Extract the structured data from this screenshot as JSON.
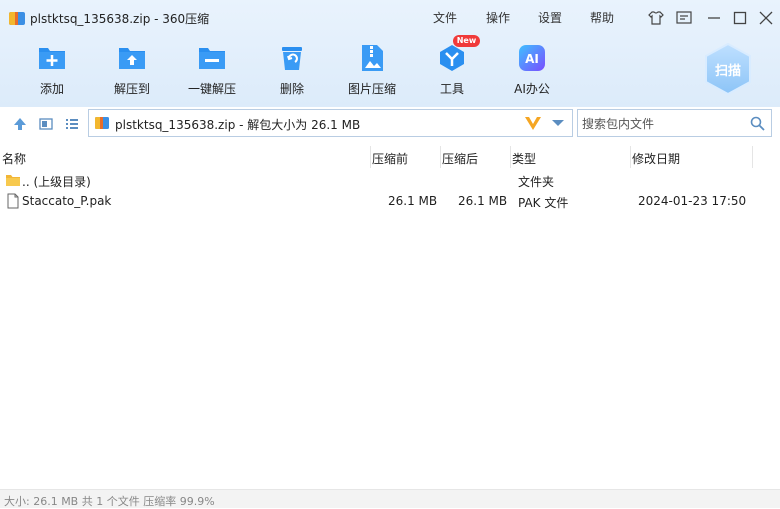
{
  "window": {
    "title": "plstktsq_135638.zip - 360压缩",
    "menu": [
      "文件",
      "操作",
      "设置",
      "帮助"
    ]
  },
  "toolbar": {
    "items": [
      {
        "label": "添加",
        "icon": "add-icon"
      },
      {
        "label": "解压到",
        "icon": "extract-to-icon"
      },
      {
        "label": "一键解压",
        "icon": "one-click-extract-icon"
      },
      {
        "label": "删除",
        "icon": "delete-icon"
      },
      {
        "label": "图片压缩",
        "icon": "image-compress-icon"
      },
      {
        "label": "工具",
        "icon": "tools-icon"
      },
      {
        "label": "AI办公",
        "icon": "ai-office-icon"
      }
    ],
    "badge": "New",
    "scan_label": "扫描"
  },
  "address": {
    "path_text": "plstktsq_135638.zip - 解包大小为 26.1 MB"
  },
  "search": {
    "placeholder": "搜索包内文件"
  },
  "table": {
    "columns": [
      "名称",
      "压缩前",
      "压缩后",
      "类型",
      "修改日期"
    ],
    "rows": [
      {
        "name": ".. (上级目录)",
        "before": "",
        "after": "",
        "type": "文件夹",
        "date": "",
        "icon": "folder-icon"
      },
      {
        "name": "Staccato_P.pak",
        "before": "26.1 MB",
        "after": "26.1 MB",
        "type": "PAK 文件",
        "date": "2024-01-23 17:50",
        "icon": "file-icon"
      }
    ]
  },
  "status": {
    "text": "大小: 26.1 MB 共 1 个文件 压缩率 99.9%"
  },
  "colors": {
    "accent": "#2a8ff0",
    "toolbar_bg": "#e4effb",
    "badge": "#f03a3a"
  }
}
